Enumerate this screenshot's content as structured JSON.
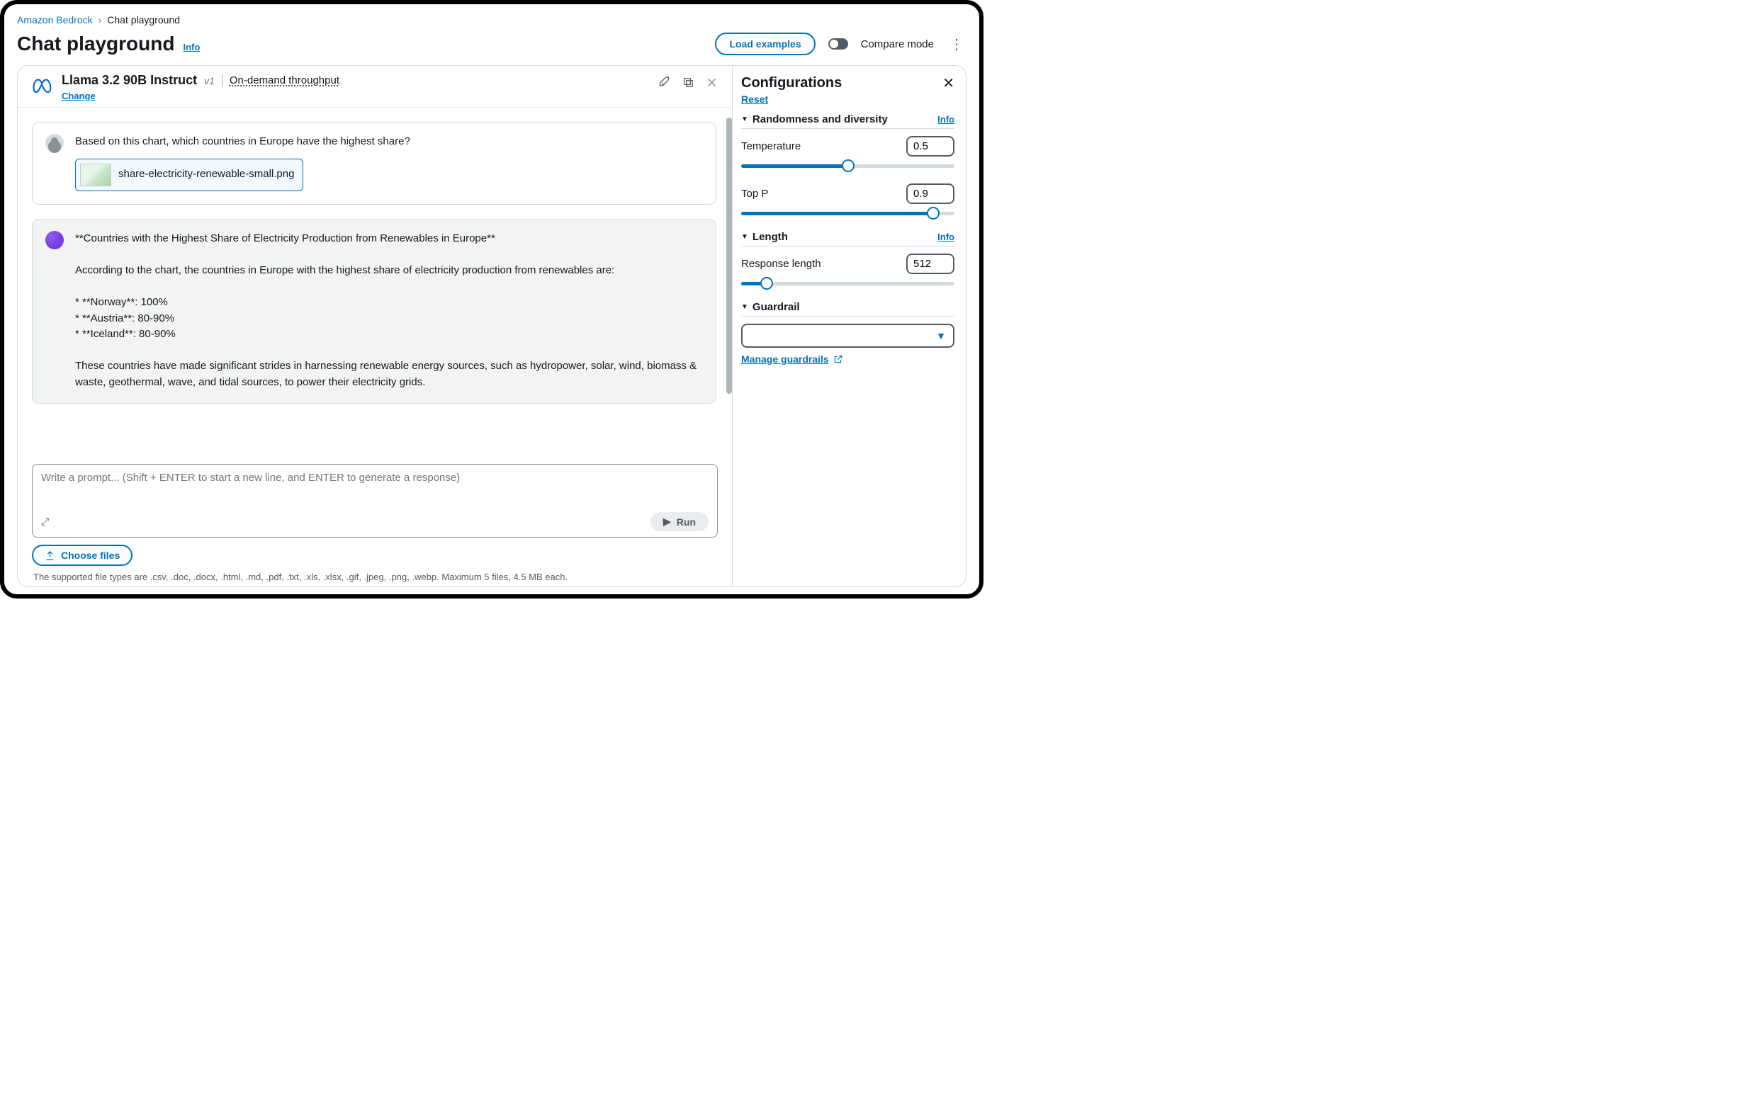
{
  "breadcrumb": {
    "root": "Amazon Bedrock",
    "current": "Chat playground"
  },
  "header": {
    "title": "Chat playground",
    "info": "Info",
    "load_examples": "Load examples",
    "compare_mode": "Compare mode"
  },
  "model": {
    "name": "Llama 3.2 90B Instruct",
    "version": "v1",
    "throughput": "On-demand throughput",
    "change": "Change"
  },
  "chat": {
    "user_msg": "Based on this chart, which countries in Europe have the highest share?",
    "attachment_name": "share-electricity-renewable-small.png",
    "assistant_heading": "**Countries with the Highest Share of Electricity Production from Renewables in Europe**",
    "assistant_intro": "According to the chart, the countries in Europe with the highest share of electricity production from renewables are:",
    "bullet1": "*   **Norway**: 100%",
    "bullet2": "*   **Austria**: 80-90%",
    "bullet3": "*   **Iceland**: 80-90%",
    "assistant_outro": "These countries have made significant strides in harnessing renewable energy sources, such as hydropower, solar, wind, biomass & waste, geothermal, wave, and tidal sources, to power their electricity grids."
  },
  "input": {
    "placeholder": "Write a prompt... (Shift + ENTER to start a new line, and ENTER to generate a response)",
    "run": "Run",
    "choose_files": "Choose files",
    "file_hint": "The supported file types are .csv, .doc, .docx, .html, .md, .pdf, .txt, .xls, .xlsx, .gif, .jpeg, .png, .webp. Maximum 5 files, 4.5 MB each."
  },
  "config": {
    "title": "Configurations",
    "reset": "Reset",
    "section_random": "Randomness and diversity",
    "info": "Info",
    "temperature_label": "Temperature",
    "temperature_value": "0.5",
    "temperature_pct": 50,
    "topp_label": "Top P",
    "topp_value": "0.9",
    "topp_pct": 90,
    "section_length": "Length",
    "resp_len_label": "Response length",
    "resp_len_value": "512",
    "resp_len_pct": 12,
    "section_guardrail": "Guardrail",
    "guardrail_value": "",
    "manage_guardrails": "Manage guardrails"
  }
}
